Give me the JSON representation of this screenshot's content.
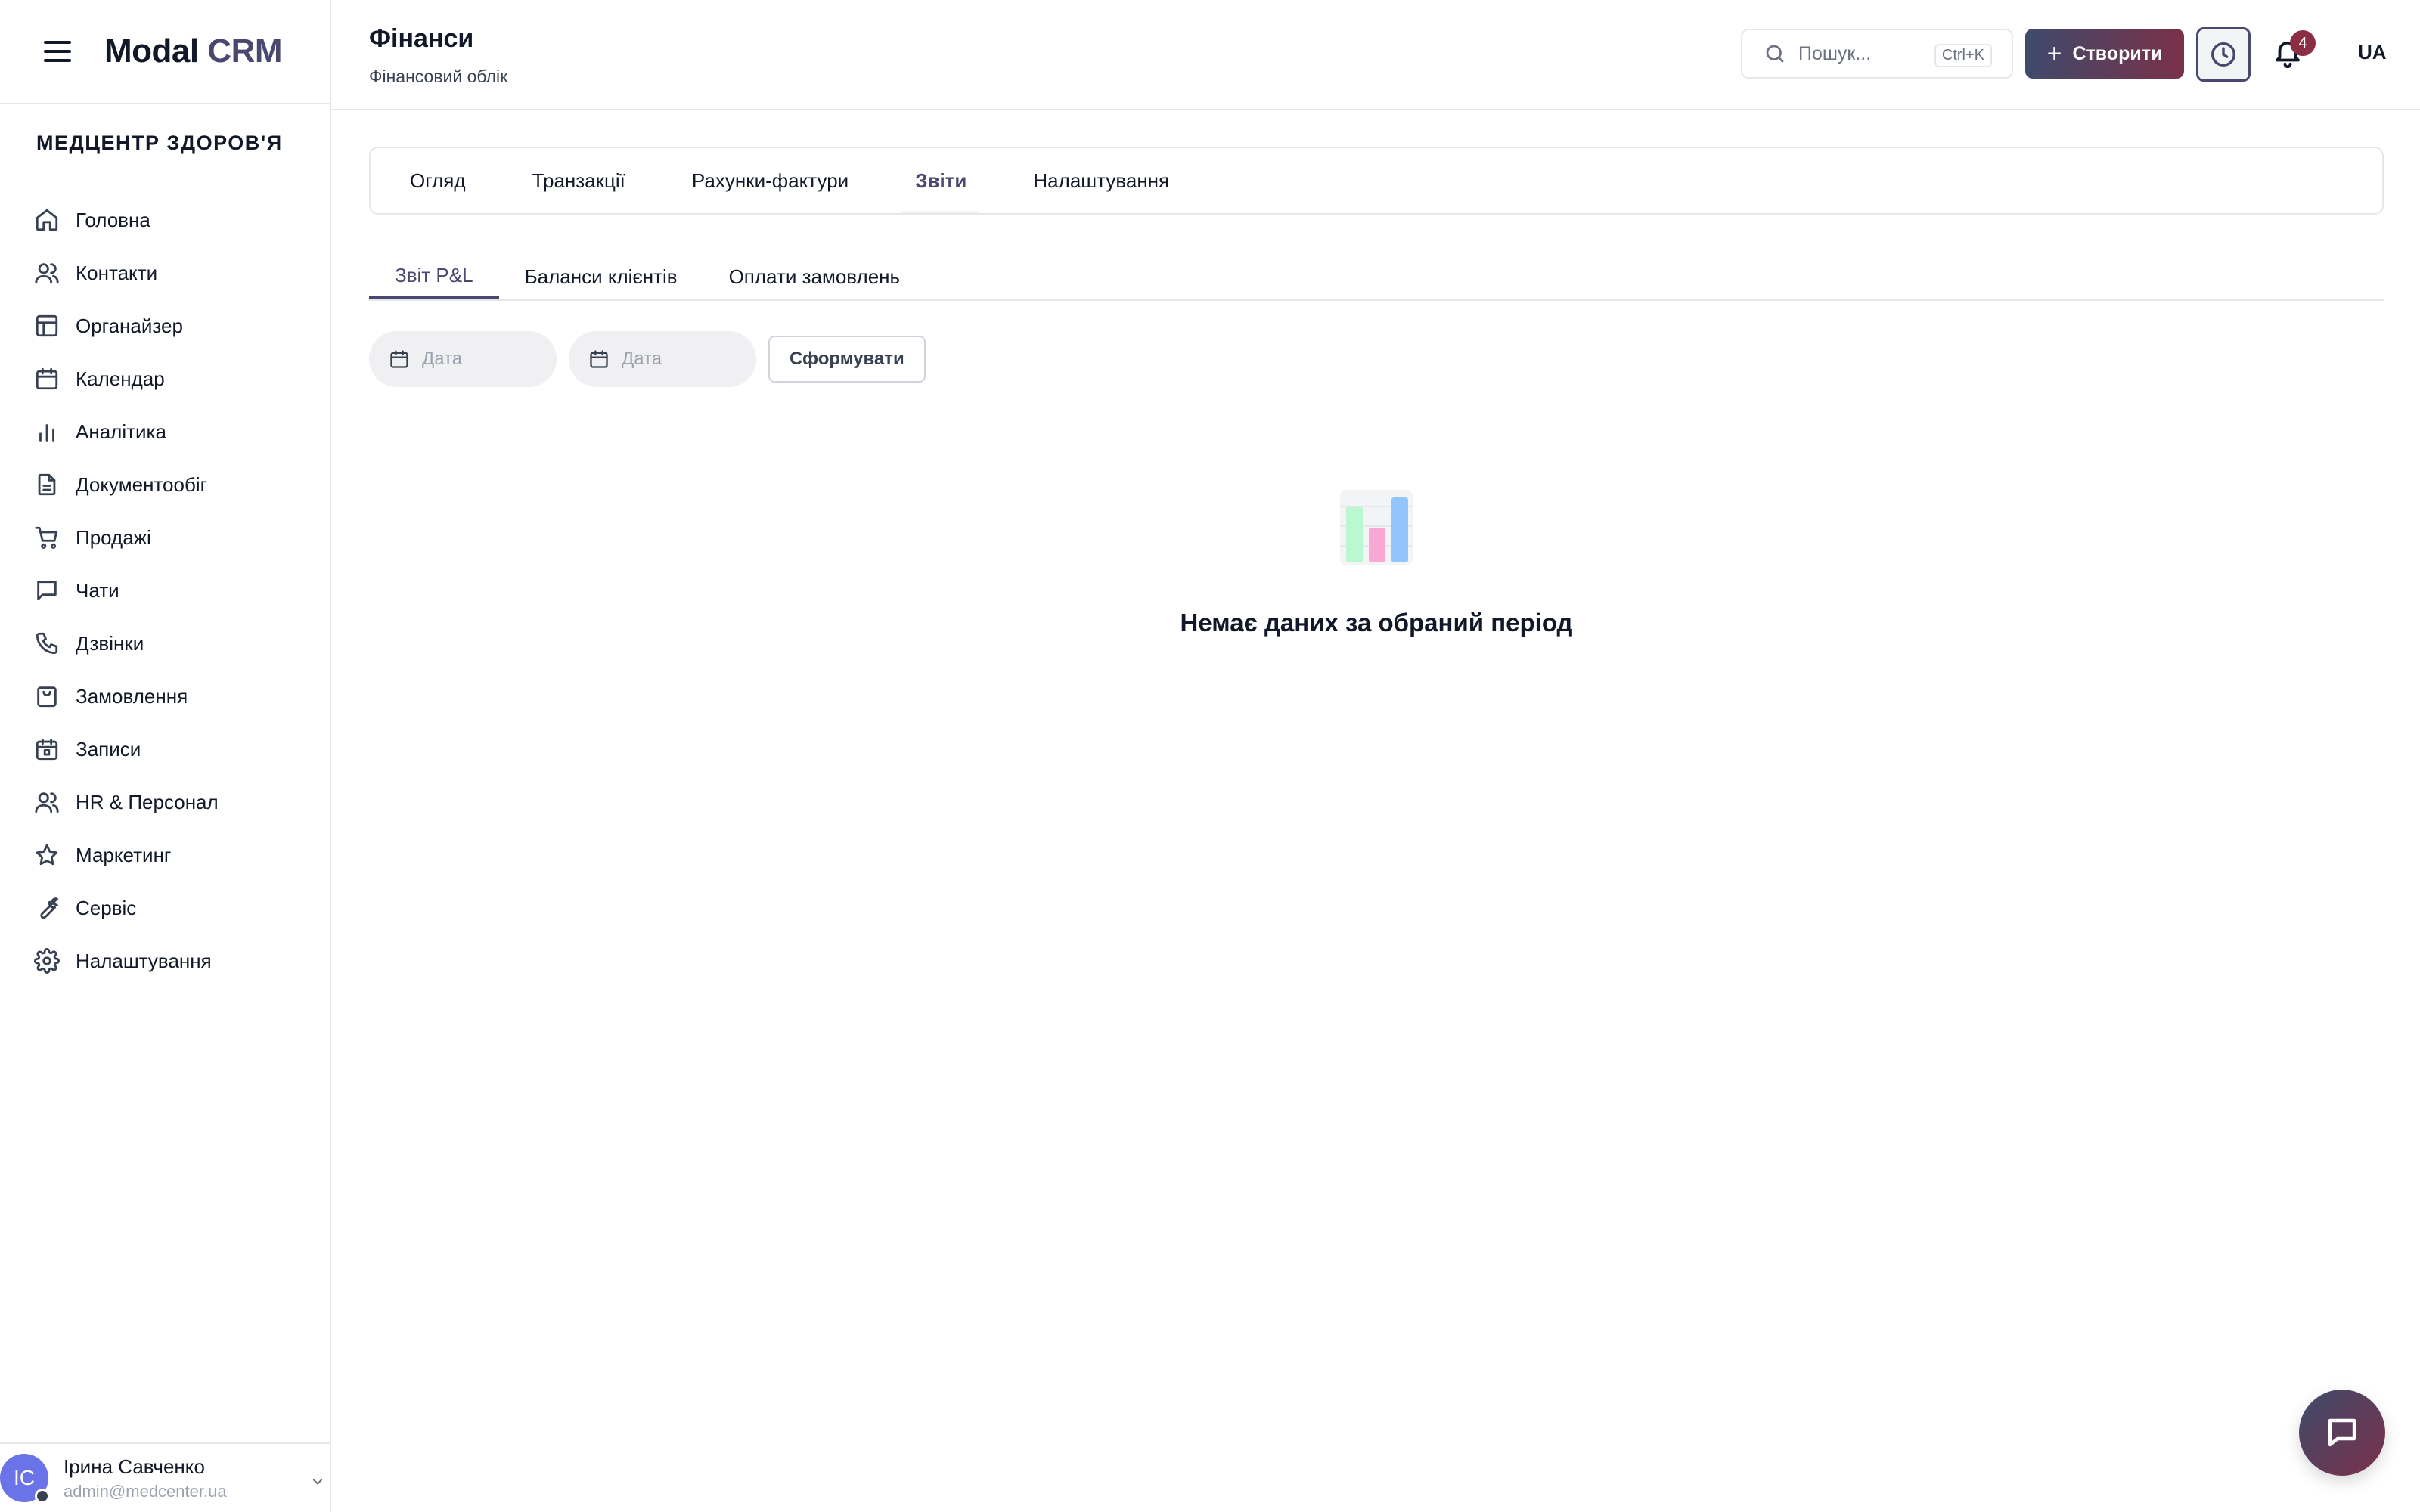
{
  "app": {
    "logo_main": "Modal",
    "logo_accent": "CRM",
    "org_name": "МЕДЦЕНТР ЗДОРОВ'Я"
  },
  "sidebar": {
    "items": [
      {
        "label": "Головна",
        "icon": "home-icon"
      },
      {
        "label": "Контакти",
        "icon": "users-icon"
      },
      {
        "label": "Органайзер",
        "icon": "layout-icon"
      },
      {
        "label": "Календар",
        "icon": "calendar-icon"
      },
      {
        "label": "Аналітика",
        "icon": "bar-chart-icon"
      },
      {
        "label": "Документообіг",
        "icon": "document-icon"
      },
      {
        "label": "Продажі",
        "icon": "cart-icon"
      },
      {
        "label": "Чати",
        "icon": "chat-icon"
      },
      {
        "label": "Дзвінки",
        "icon": "phone-icon"
      },
      {
        "label": "Замовлення",
        "icon": "shopping-bag-icon"
      },
      {
        "label": "Записи",
        "icon": "calendar-check-icon"
      },
      {
        "label": "HR & Персонал",
        "icon": "users-icon"
      },
      {
        "label": "Маркетинг",
        "icon": "star-icon"
      },
      {
        "label": "Сервіс",
        "icon": "wrench-icon"
      },
      {
        "label": "Налаштування",
        "icon": "gear-icon"
      }
    ]
  },
  "user": {
    "initials": "ІС",
    "name": "Ірина Савченко",
    "email": "admin@medcenter.ua"
  },
  "header": {
    "title": "Фінанси",
    "subtitle": "Фінансовий облік",
    "search_placeholder": "Пошук...",
    "search_shortcut": "Ctrl+K",
    "create_label": "Створити",
    "notifications_count": "4",
    "language": "UA"
  },
  "tabs": [
    {
      "label": "Огляд",
      "active": false
    },
    {
      "label": "Транзакції",
      "active": false
    },
    {
      "label": "Рахунки-фактури",
      "active": false
    },
    {
      "label": "Звіти",
      "active": true
    },
    {
      "label": "Налаштування",
      "active": false
    }
  ],
  "subtabs": [
    {
      "label": "Звіт P&L",
      "active": true
    },
    {
      "label": "Баланси клієнтів",
      "active": false
    },
    {
      "label": "Оплати замовлень",
      "active": false
    }
  ],
  "filters": {
    "date_from_placeholder": "Дата",
    "date_to_placeholder": "Дата",
    "generate_label": "Сформувати"
  },
  "empty_state": {
    "message": "Немає даних за обраний період"
  },
  "colors": {
    "accent": "#4a4870",
    "brand_gradient_start": "#3f4a6c",
    "brand_gradient_end": "#7a3148",
    "badge": "#8a2e46"
  }
}
